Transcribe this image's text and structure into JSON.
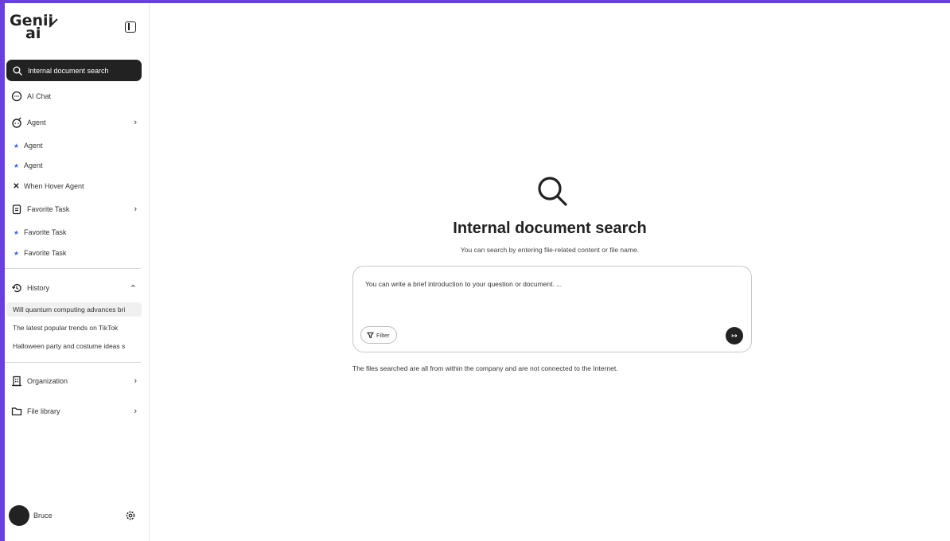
{
  "app": {
    "logo_line1": "Genii",
    "logo_line2": "ai"
  },
  "sidebar": {
    "active_item": "Internal document search",
    "items": {
      "ai_chat": "AI Chat",
      "agent": "Agent",
      "favorite_task": "Favorite Task",
      "history": "History",
      "organization": "Organization",
      "file_library": "File library"
    },
    "agent_subitems": [
      "Agent",
      "Agent",
      "When Hover Agent"
    ],
    "favorite_subitems": [
      "Favorite Task",
      "Favorite Task"
    ],
    "history_items": [
      "Will quantum computing advances bri",
      "The latest popular trends on TikTok",
      "Halloween party and costume ideas s"
    ]
  },
  "user": {
    "name": "Bruce"
  },
  "main": {
    "title": "Internal document search",
    "subtitle": "You can search by entering file-related content or file name.",
    "input_placeholder": "You can write a brief introduction to your question or document. ...",
    "filter_label": "Filter",
    "note": "The files searched are all from within the company and are not connected to the Internet."
  },
  "icons": {
    "search": "search-icon",
    "chat": "chat-bubble-icon",
    "agent": "robot-icon",
    "pin": "pin-icon",
    "close": "close-icon",
    "task": "clipboard-icon",
    "history": "history-icon",
    "organization": "building-icon",
    "folder": "folder-icon",
    "settings": "gear-icon",
    "send": "send-arrow-icon",
    "filter": "filter-icon"
  },
  "colors": {
    "accent": "#222222",
    "pin": "#3b63e6",
    "frame": "#6a3fe0"
  }
}
